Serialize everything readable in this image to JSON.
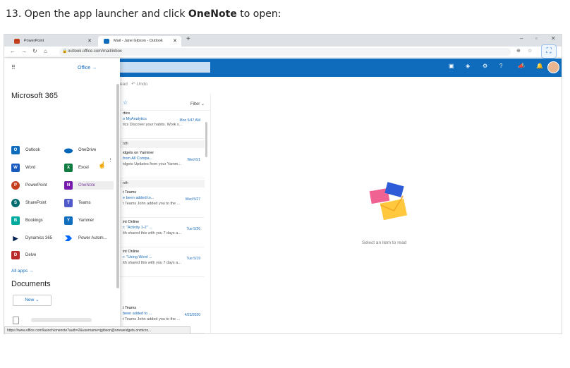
{
  "instruction": {
    "prefix": "13. Open the app launcher and click ",
    "emphasis": "OneNote",
    "suffix": " to open:"
  },
  "browser": {
    "tabs": [
      {
        "label": "PowerPoint",
        "icon": "powerpoint-icon"
      },
      {
        "label": "Mail - Jane Gibson - Outlook",
        "icon": "outlook-icon"
      }
    ],
    "url": "outlook.office.com/mail/inbox",
    "status_url": "https://www.office.com/launch/onenote?auth=2&username=jgibson@oneweidgets.onmicro..."
  },
  "launcher": {
    "office_link": "Office  →",
    "heading": "Microsoft 365",
    "apps": [
      {
        "label": "Outlook",
        "letter": "O",
        "color": "#0f6cbd"
      },
      {
        "label": "OneDrive",
        "letter": "",
        "color": "#0364b8"
      },
      {
        "label": "Word",
        "letter": "W",
        "color": "#185abd"
      },
      {
        "label": "Excel",
        "letter": "X",
        "color": "#107c41"
      },
      {
        "label": "PowerPoint",
        "letter": "P",
        "color": "#c43e1c"
      },
      {
        "label": "OneNote",
        "letter": "N",
        "color": "#7719aa"
      },
      {
        "label": "SharePoint",
        "letter": "S",
        "color": "#036c70"
      },
      {
        "label": "Teams",
        "letter": "T",
        "color": "#5059c9"
      },
      {
        "label": "Bookings",
        "letter": "B",
        "color": "#00a99d"
      },
      {
        "label": "Yammer",
        "letter": "Y",
        "color": "#106ebe"
      },
      {
        "label": "Dynamics 365",
        "letter": "▶",
        "color": "#002050"
      },
      {
        "label": "Power Autom...",
        "letter": "",
        "color": "#0066ff"
      },
      {
        "label": "Delve",
        "letter": "D",
        "color": "#b92b2b"
      }
    ],
    "all_apps": "All apps  →",
    "documents_heading": "Documents",
    "new_button": "New  ⌄"
  },
  "mail": {
    "command_read": "ead",
    "command_undo": "Undo",
    "filter_label": "Filter ⌄",
    "groups": [
      "rtics",
      "nth",
      "nth"
    ],
    "items": [
      {
        "sender": "rtics",
        "subject": "o MyAnalytics",
        "date": "Mon 5/47 AM",
        "preview": "tics Discover your habits. Work s..."
      },
      {
        "sender": "idgets on Yammer",
        "subject": "from All Compa...",
        "date": "Wed 6/1",
        "preview": "idgets Updates from your Yamm..."
      },
      {
        "sender": "t Teams",
        "subject": "e been added to...",
        "date": "Wed 5/27",
        "preview": "t Teams John added you to the ..."
      },
      {
        "sender": "int Online",
        "subject": "r: \"Activity 1-2\" ...",
        "date": "Tue 5/26",
        "preview": "ith shared this with you 7 days a..."
      },
      {
        "sender": "int Online",
        "subject": "r: \"Using Word ...",
        "date": "Tue 5/19",
        "preview": "ith shared this with you 7 days a..."
      },
      {
        "sender": "t Teams",
        "subject": "been added to ...",
        "date": "4/23/2020",
        "preview": "t Teams John added you to the ..."
      }
    ],
    "reading_pane_text": "Select an item to read"
  }
}
